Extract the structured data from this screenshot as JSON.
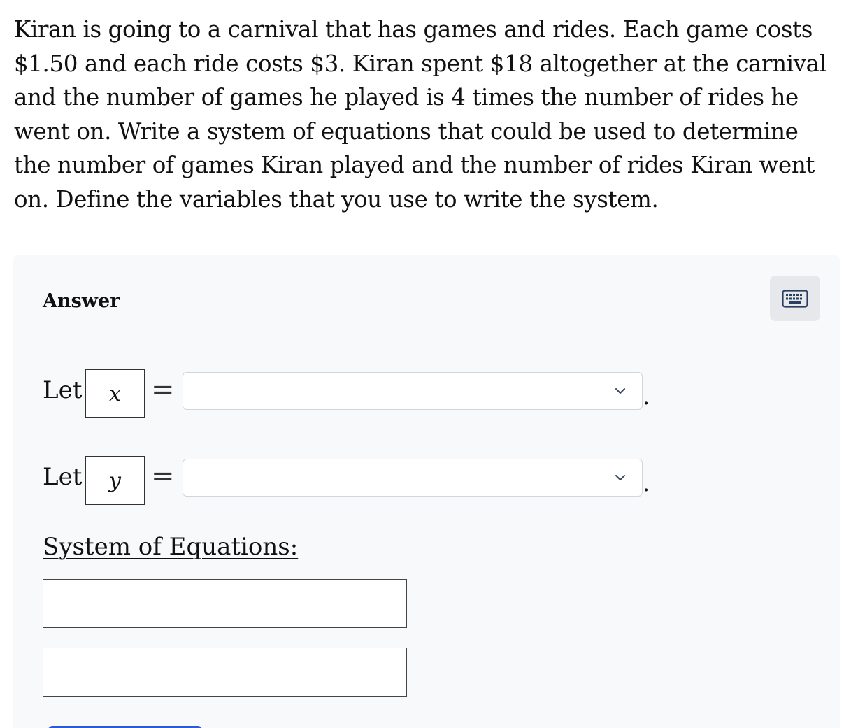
{
  "question": {
    "text": "Kiran is going to a carnival that has games and rides. Each game costs $1.50 and each ride costs $3. Kiran spent $18 altogether at the carnival and the number of games he played is 4 times the number of rides he went on. Write a system of equations that could be used to determine the number of games Kiran played and the number of rides Kiran went on. Define the variables that you use to write the system."
  },
  "answer": {
    "label": "Answer",
    "keyboard_icon": "keyboard-icon",
    "rows": [
      {
        "let_label": "Let",
        "variable": "x",
        "equals": "=",
        "selected_value": "",
        "period": "."
      },
      {
        "let_label": "Let",
        "variable": "y",
        "equals": "=",
        "selected_value": "",
        "period": "."
      }
    ],
    "system_label": "System of Equations:",
    "equations": [
      "",
      ""
    ]
  },
  "colors": {
    "panel_background": "#f8f9fb",
    "keyboard_button": "#e6e8ec",
    "submit_accent": "#2a5bd7"
  }
}
